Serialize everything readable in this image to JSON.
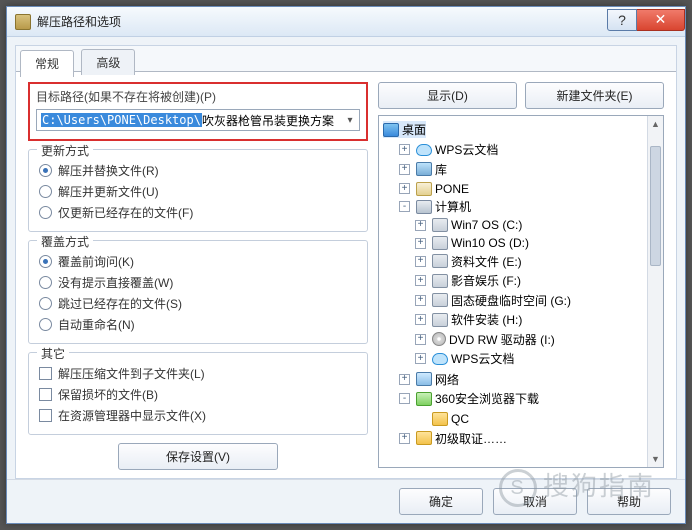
{
  "window": {
    "title": "解压路径和选项",
    "help_glyph": "?",
    "close_glyph": "✕"
  },
  "tabs": {
    "general": "常规",
    "advanced": "高级"
  },
  "path": {
    "label": "目标路径(如果不存在将被创建)(P)",
    "prefix": "C:\\Users\\PONE\\Desktop\\",
    "folder": "吹灰器枪管吊装更换方案",
    "dropdown_glyph": "▾"
  },
  "rightButtons": {
    "show": "显示(D)",
    "newFolder": "新建文件夹(E)"
  },
  "groups": {
    "update": {
      "title": "更新方式",
      "opts": [
        "解压并替换文件(R)",
        "解压并更新文件(U)",
        "仅更新已经存在的文件(F)"
      ],
      "selected": 0
    },
    "overwrite": {
      "title": "覆盖方式",
      "opts": [
        "覆盖前询问(K)",
        "没有提示直接覆盖(W)",
        "跳过已经存在的文件(S)",
        "自动重命名(N)"
      ],
      "selected": 0
    },
    "other": {
      "title": "其它",
      "opts": [
        "解压压缩文件到子文件夹(L)",
        "保留损坏的文件(B)",
        "在资源管理器中显示文件(X)"
      ]
    }
  },
  "save": "保存设置(V)",
  "tree": {
    "root": "桌面",
    "items": [
      {
        "exp": "+",
        "icon": "i-cloud",
        "label": "WPS云文档"
      },
      {
        "exp": "+",
        "icon": "i-lib",
        "label": "库"
      },
      {
        "exp": "+",
        "icon": "i-user",
        "label": "PONE"
      },
      {
        "exp": "-",
        "icon": "i-pc",
        "label": "计算机",
        "children": [
          {
            "exp": "+",
            "icon": "i-hdd",
            "label": "Win7 OS (C:)"
          },
          {
            "exp": "+",
            "icon": "i-hdd",
            "label": "Win10 OS (D:)"
          },
          {
            "exp": "+",
            "icon": "i-hdd",
            "label": "资料文件 (E:)"
          },
          {
            "exp": "+",
            "icon": "i-hdd",
            "label": "影音娱乐 (F:)"
          },
          {
            "exp": "+",
            "icon": "i-hdd",
            "label": "固态硬盘临时空间 (G:)"
          },
          {
            "exp": "+",
            "icon": "i-hdd",
            "label": "软件安装 (H:)"
          },
          {
            "exp": "+",
            "icon": "i-dvd",
            "label": "DVD RW 驱动器 (I:)"
          },
          {
            "exp": "+",
            "icon": "i-cloud",
            "label": "WPS云文档"
          }
        ]
      },
      {
        "exp": "+",
        "icon": "i-net",
        "label": "网络"
      },
      {
        "exp": "-",
        "icon": "i-360",
        "label": "360安全浏览器下载",
        "children": [
          {
            "exp": "",
            "icon": "i-folder",
            "label": "QC"
          }
        ]
      },
      {
        "exp": "+",
        "icon": "i-folder",
        "label": "初级取证……"
      }
    ]
  },
  "footer": {
    "ok": "确定",
    "cancel": "取消",
    "help": "帮助"
  },
  "watermark": {
    "icon": "S",
    "text": "搜狗指南"
  }
}
